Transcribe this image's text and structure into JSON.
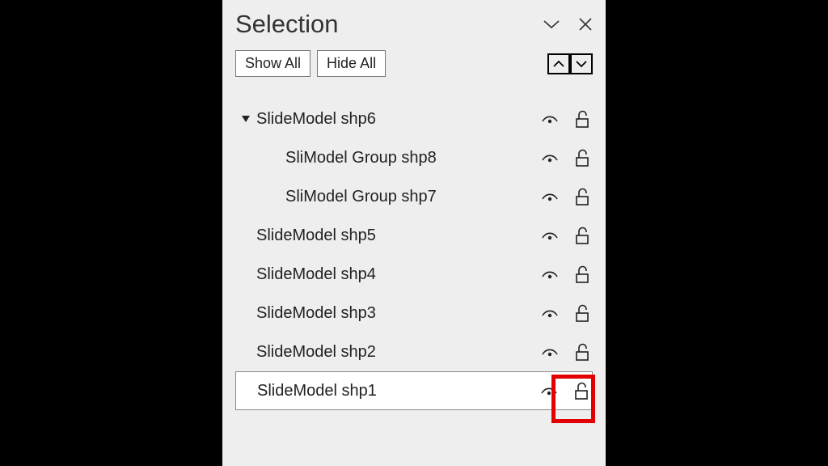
{
  "header": {
    "title": "Selection"
  },
  "toolbar": {
    "show_all": "Show All",
    "hide_all": "Hide All"
  },
  "items": [
    {
      "label": "SlideModel shp6",
      "indent": 0,
      "expanded": true,
      "selected": false,
      "highlight_lock": false
    },
    {
      "label": "SliModel Group shp8",
      "indent": 1,
      "expanded": null,
      "selected": false,
      "highlight_lock": false
    },
    {
      "label": "SliModel Group shp7",
      "indent": 1,
      "expanded": null,
      "selected": false,
      "highlight_lock": false
    },
    {
      "label": "SlideModel shp5",
      "indent": 0,
      "expanded": null,
      "selected": false,
      "highlight_lock": false
    },
    {
      "label": "SlideModel shp4",
      "indent": 0,
      "expanded": null,
      "selected": false,
      "highlight_lock": false
    },
    {
      "label": "SlideModel shp3",
      "indent": 0,
      "expanded": null,
      "selected": false,
      "highlight_lock": false
    },
    {
      "label": "SlideModel shp2",
      "indent": 0,
      "expanded": null,
      "selected": false,
      "highlight_lock": false
    },
    {
      "label": "SlideModel shp1",
      "indent": 0,
      "expanded": null,
      "selected": true,
      "highlight_lock": true
    }
  ]
}
